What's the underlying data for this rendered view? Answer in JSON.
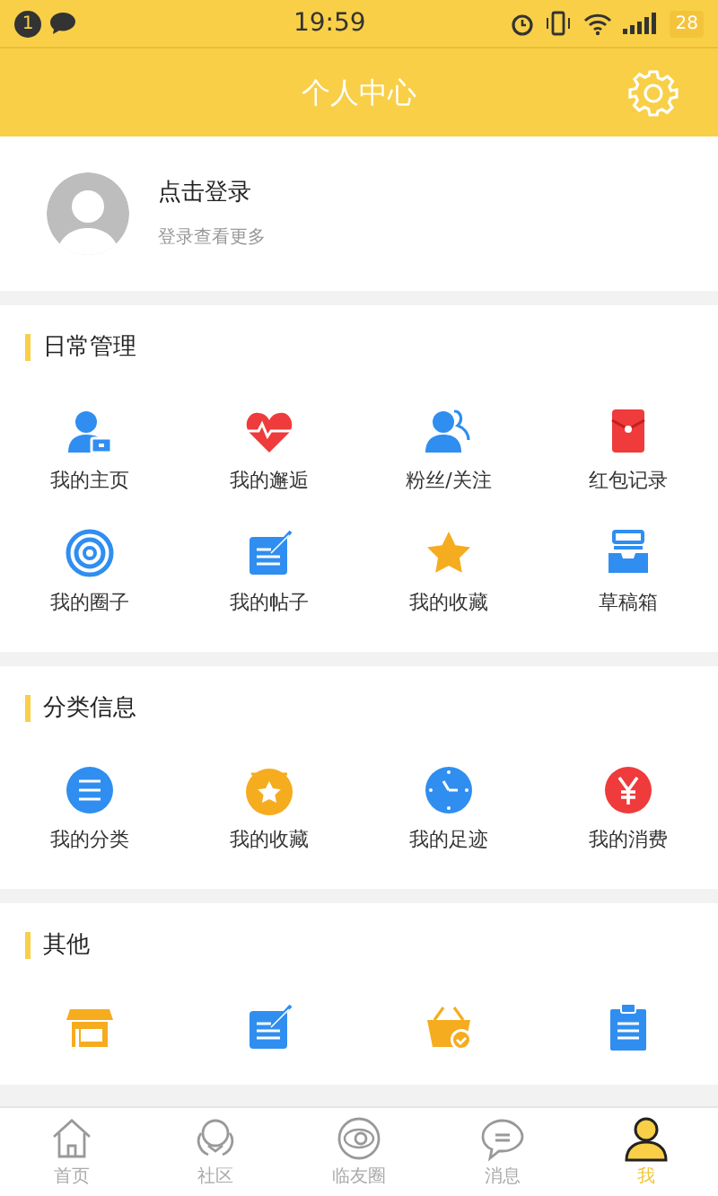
{
  "status_bar": {
    "notification_count": "1",
    "time": "19:59",
    "battery": "28"
  },
  "header": {
    "title": "个人中心"
  },
  "profile": {
    "name": "点击登录",
    "hint": "登录查看更多"
  },
  "sections": [
    {
      "title": "日常管理",
      "items": [
        {
          "label": "我的主页",
          "kind": "home-user"
        },
        {
          "label": "我的邂逅",
          "kind": "heart"
        },
        {
          "label": "粉丝/关注",
          "kind": "people"
        },
        {
          "label": "红包记录",
          "kind": "envelope"
        },
        {
          "label": "我的圈子",
          "kind": "target"
        },
        {
          "label": "我的帖子",
          "kind": "note"
        },
        {
          "label": "我的收藏",
          "kind": "star"
        },
        {
          "label": "草稿箱",
          "kind": "tray"
        }
      ]
    },
    {
      "title": "分类信息",
      "items": [
        {
          "label": "我的分类",
          "kind": "list-circle"
        },
        {
          "label": "我的收藏",
          "kind": "star-circle"
        },
        {
          "label": "我的足迹",
          "kind": "clock"
        },
        {
          "label": "我的消费",
          "kind": "yen"
        }
      ]
    },
    {
      "title": "其他",
      "items": [
        {
          "kind": "shop"
        },
        {
          "kind": "note"
        },
        {
          "kind": "basket"
        },
        {
          "kind": "clipboard"
        }
      ]
    }
  ],
  "tab_bar": [
    {
      "label": "首页",
      "kind": "home",
      "selected": false
    },
    {
      "label": "社区",
      "kind": "community",
      "selected": false
    },
    {
      "label": "临友圈",
      "kind": "circle",
      "selected": false
    },
    {
      "label": "消息",
      "kind": "message",
      "selected": false
    },
    {
      "label": "我",
      "kind": "me",
      "selected": true
    }
  ]
}
